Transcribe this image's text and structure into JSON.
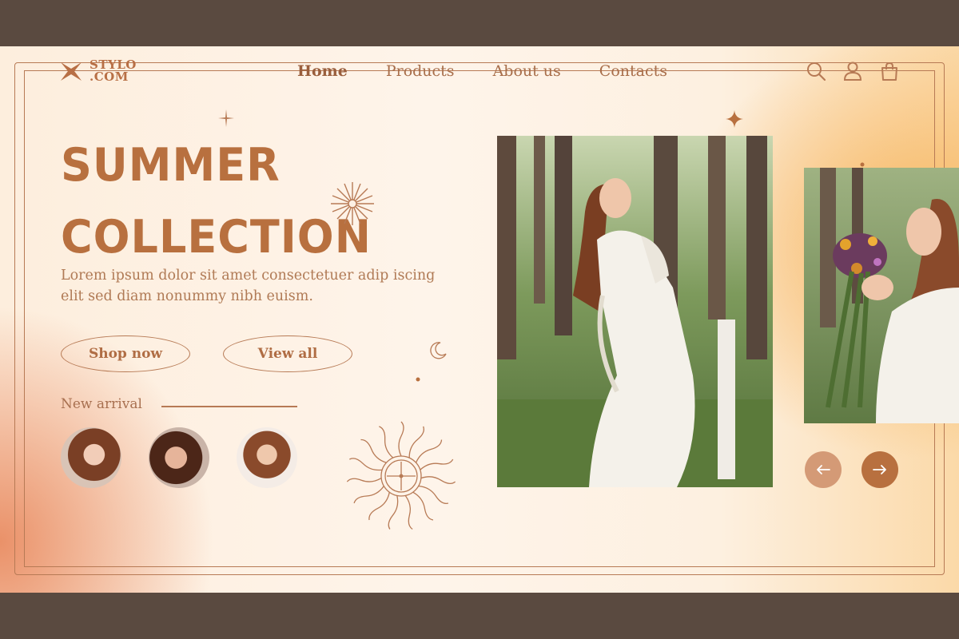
{
  "brand": {
    "line1": "STYLO",
    "line2": ".COM"
  },
  "nav": {
    "items": [
      {
        "label": "Home",
        "active": true
      },
      {
        "label": "Products",
        "active": false
      },
      {
        "label": "About us",
        "active": false
      },
      {
        "label": "Contacts",
        "active": false
      }
    ]
  },
  "header_icons": [
    "search-icon",
    "user-icon",
    "shopping-bag-icon"
  ],
  "hero": {
    "headline_line1": "SUMMER",
    "headline_line2": "COLLECTION",
    "body": "Lorem ipsum dolor sit amet consectetuer adip iscing elit sed diam nonummy nibh euism."
  },
  "buttons": {
    "shop": "Shop now",
    "view": "View all"
  },
  "arrival": {
    "label": "New arrival"
  },
  "carousel": {
    "prev_icon": "arrow-left-icon",
    "next_icon": "arrow-right-icon"
  },
  "colors": {
    "accent": "#b8703f",
    "line": "#b77a55",
    "band": "#5a4a40"
  }
}
